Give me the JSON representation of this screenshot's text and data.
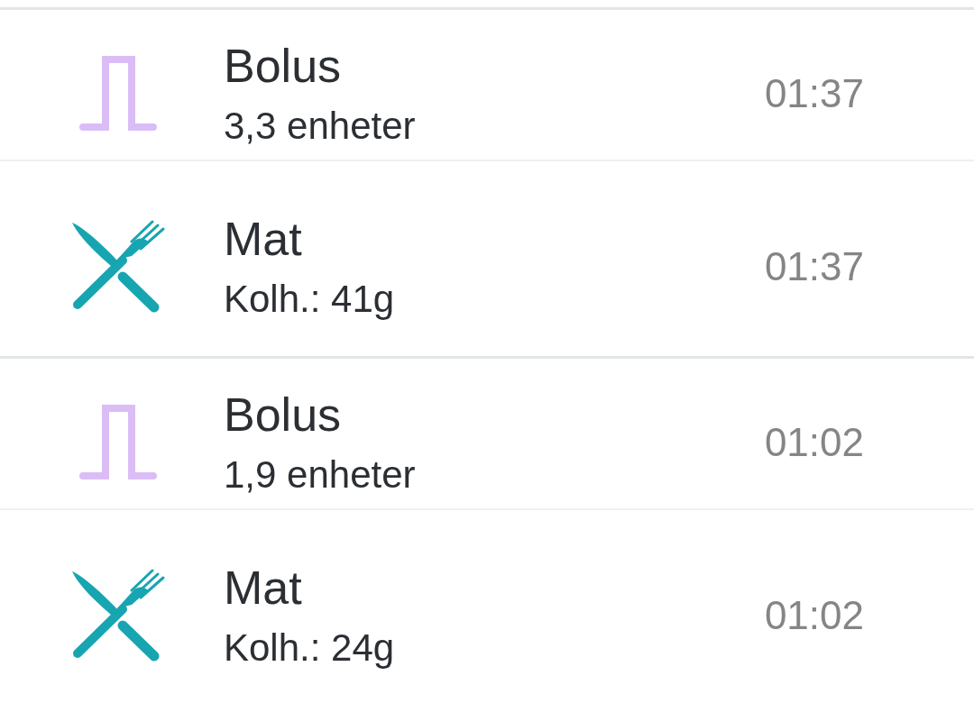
{
  "history": {
    "groups": [
      {
        "entries": [
          {
            "kind": "bolus",
            "title": "Bolus",
            "detail": "3,3 enheter",
            "time": "01:37"
          },
          {
            "kind": "meal",
            "title": "Mat",
            "detail": "Kolh.: 41g",
            "time": "01:37"
          }
        ]
      },
      {
        "entries": [
          {
            "kind": "bolus",
            "title": "Bolus",
            "detail": "1,9 enheter",
            "time": "01:02"
          },
          {
            "kind": "meal",
            "title": "Mat",
            "detail": "Kolh.: 24g",
            "time": "01:02"
          }
        ]
      }
    ]
  }
}
